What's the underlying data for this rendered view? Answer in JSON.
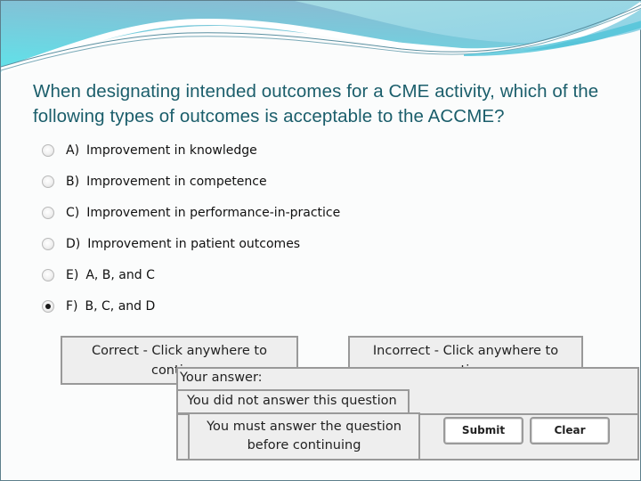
{
  "slide": {
    "question": "When designating intended outcomes for a CME activity, which of the following types of outcomes is acceptable to the ACCME?",
    "options": [
      {
        "letter": "A)",
        "text": "Improvement in knowledge",
        "selected": false
      },
      {
        "letter": "B)",
        "text": "Improvement in competence",
        "selected": false
      },
      {
        "letter": "C)",
        "text": "Improvement in performance-in-practice",
        "selected": false
      },
      {
        "letter": "D)",
        "text": "Improvement in patient outcomes",
        "selected": false
      },
      {
        "letter": "E)",
        "text": "A, B, and C",
        "selected": false
      },
      {
        "letter": "F)",
        "text": "B, C, and D",
        "selected": true
      }
    ]
  },
  "feedback": {
    "correct": "Correct - Click anywhere to continue",
    "incorrect": "Incorrect - Click anywhere to continue",
    "your_answer_label": "Your answer:",
    "not_answered": "You did not answer this question",
    "must_answer": "You must answer the question before continuing"
  },
  "buttons": {
    "submit": "Submit",
    "clear": "Clear"
  },
  "colors": {
    "question_text": "#1b5e6b",
    "header_teal": "#6fd0dc",
    "panel_bg": "#eeeeee",
    "panel_border": "#999999"
  }
}
